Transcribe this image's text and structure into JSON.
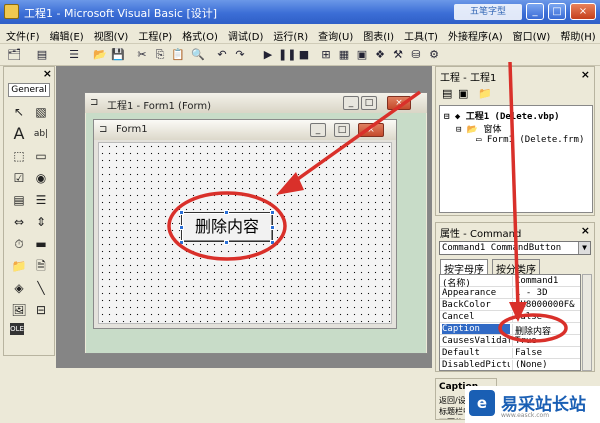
{
  "window": {
    "title": "工程1 - Microsoft Visual Basic [设计]",
    "watermark": "五笔字型",
    "min": "_",
    "max": "□",
    "close": "×"
  },
  "menu": [
    "文件(F)",
    "编辑(E)",
    "视图(V)",
    "工程(P)",
    "格式(O)",
    "调试(D)",
    "运行(R)",
    "查询(U)",
    "图表(I)",
    "工具(T)",
    "外接程序(A)",
    "窗口(W)",
    "帮助(H)"
  ],
  "toolbox": {
    "header": "General",
    "close": "×"
  },
  "design_window": {
    "title": "工程1 - Form1 (Form)"
  },
  "form": {
    "title": "Form1",
    "button_caption": "删除内容"
  },
  "project": {
    "title": "工程 - 工程1",
    "close": "×",
    "tree": [
      "工程1 (Delete.vbp)",
      "窗体",
      "Form1 (Delete.frm)"
    ]
  },
  "properties": {
    "title": "属性 - Command",
    "close": "×",
    "object": "Command1 CommandButton",
    "tabs": [
      "按字母序",
      "按分类序"
    ],
    "rows": [
      {
        "name": "(名称)",
        "value": "Command1"
      },
      {
        "name": "Appearance",
        "value": "1 - 3D"
      },
      {
        "name": "BackColor",
        "value": "&H8000000F&"
      },
      {
        "name": "Cancel",
        "value": "False"
      },
      {
        "name": "Caption",
        "value": "删除内容"
      },
      {
        "name": "CausesValidation",
        "value": "True"
      },
      {
        "name": "Default",
        "value": "False"
      },
      {
        "name": "DisabledPicture",
        "value": "(None)"
      }
    ],
    "desc_title": "Caption",
    "desc_text": "返回/设置对象标题栏中或图标下面的文本。"
  },
  "logo": {
    "text": "易采站长站",
    "sub": "www.easck.com"
  },
  "colors": {
    "annotation": "#d9302a",
    "titlebar": "#3c6ed6",
    "grid_bg": "#f4f4f4"
  }
}
